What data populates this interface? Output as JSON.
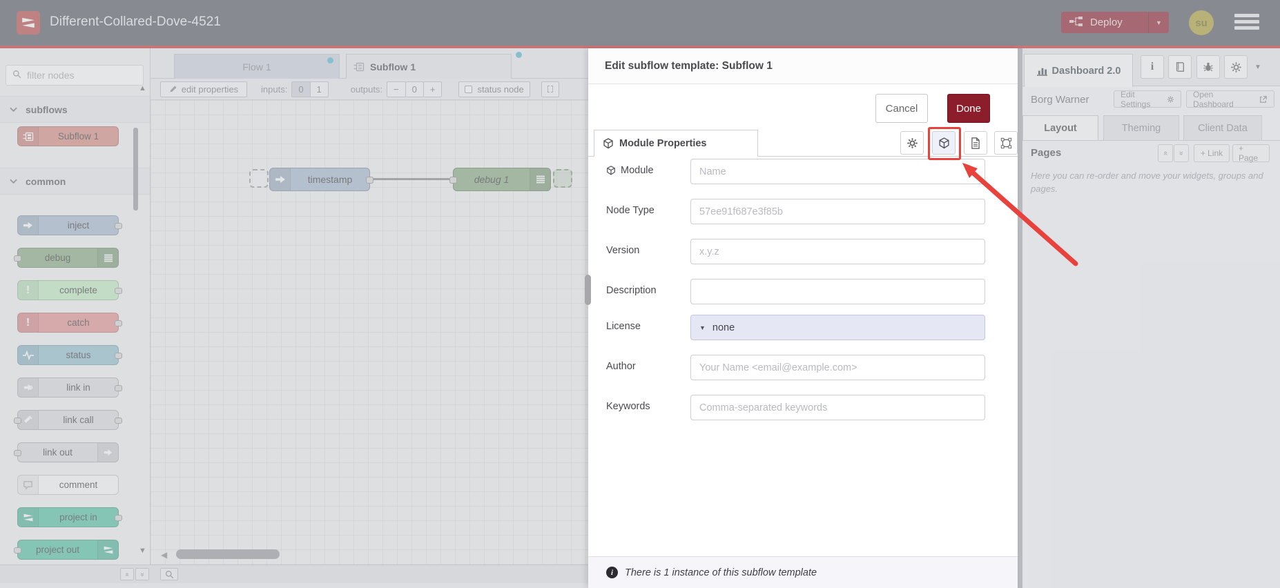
{
  "header": {
    "title": "Different-Collared-Dove-4521",
    "deploy_label": "Deploy",
    "avatar_text": "su"
  },
  "palette": {
    "filter_placeholder": "filter nodes",
    "section_subflows": "subflows",
    "section_common": "common",
    "subflow_item": "Subflow 1",
    "items": [
      {
        "label": "inject"
      },
      {
        "label": "debug"
      },
      {
        "label": "complete"
      },
      {
        "label": "catch"
      },
      {
        "label": "status"
      },
      {
        "label": "link in"
      },
      {
        "label": "link call"
      },
      {
        "label": "link out"
      },
      {
        "label": "comment"
      },
      {
        "label": "project in"
      },
      {
        "label": "project out"
      }
    ]
  },
  "workspace": {
    "tab_flow": "Flow 1",
    "tab_subflow": "Subflow 1",
    "toolbar": {
      "edit_properties": "edit properties",
      "inputs_label": "inputs:",
      "input_zero": "0",
      "input_one": "1",
      "outputs_label": "outputs:",
      "minus": "−",
      "outputs_value": "0",
      "plus": "+",
      "status_node": "status node"
    },
    "nodes": {
      "inject_label": "timestamp",
      "debug_label": "debug 1"
    }
  },
  "dialog": {
    "title": "Edit subflow template: Subflow 1",
    "cancel_label": "Cancel",
    "done_label": "Done",
    "tab_label": "Module Properties",
    "fields": [
      {
        "label": "Module",
        "placeholder": "Name"
      },
      {
        "label": "Node Type",
        "placeholder": "57ee91f687e3f85b"
      },
      {
        "label": "Version",
        "placeholder": "x.y.z"
      },
      {
        "label": "Description",
        "placeholder": ""
      },
      {
        "label": "License",
        "value": "none"
      },
      {
        "label": "Author",
        "placeholder": "Your Name <email@example.com>"
      },
      {
        "label": "Keywords",
        "placeholder": "Comma-separated keywords"
      }
    ],
    "footer_text": "There is 1 instance of this subflow template"
  },
  "sidebar": {
    "tab_label": "Dashboard 2.0",
    "project_name": "Borg Warner",
    "edit_settings_label": "Edit Settings",
    "open_dashboard_label": "Open Dashboard",
    "tabs": [
      {
        "label": "Layout"
      },
      {
        "label": "Theming"
      },
      {
        "label": "Client Data"
      }
    ],
    "pages_title": "Pages",
    "link_button": "+ Link",
    "page_button": "+ Page",
    "help_text": "Here you can re-order and move your widgets, groups and pages."
  },
  "icons": {
    "caret_down": "▼",
    "scroll_up": "▲",
    "scroll_down": "▼",
    "scroll_left": "◀",
    "double_chevron": "«"
  },
  "colors": {
    "header_bg": "#545a61",
    "brand_red": "#b94a48",
    "deploy_bg": "#8C1D2B",
    "done_bg": "#8C1D2B",
    "annotation_red": "#e8423c",
    "tab_dot_blue": "#58b7d6",
    "license_bg": "#e6e7f5",
    "node_subflow": "#d98a80",
    "node_inject": "#a6bbcf",
    "node_debug": "#87a980",
    "node_complete": "#c0edc0",
    "node_catch": "#e49191",
    "node_status": "#94c1d0",
    "node_link": "#dddde0",
    "node_comment": "#fbfbfb",
    "node_project": "#51c3a5"
  }
}
